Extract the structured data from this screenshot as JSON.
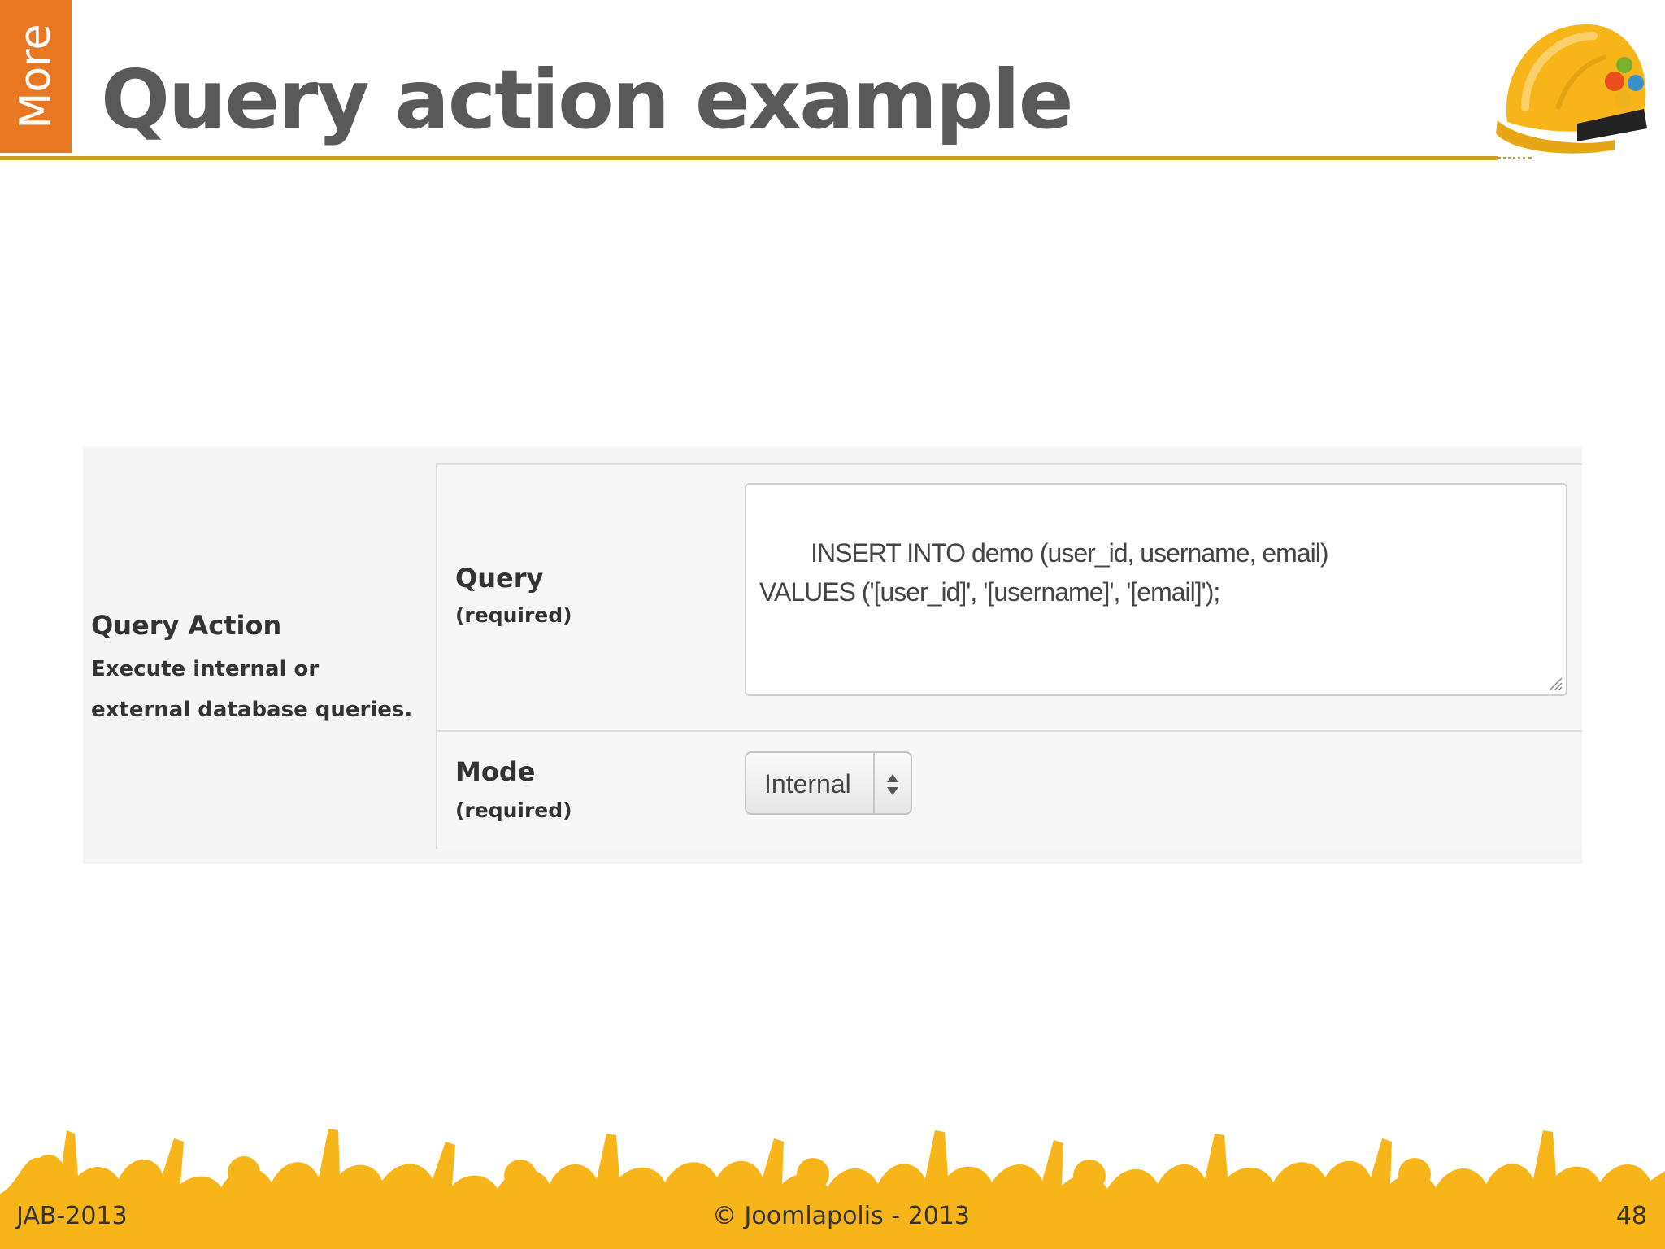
{
  "header": {
    "side_tab": "More",
    "title": "Query action example"
  },
  "panel": {
    "group_title": "Query Action",
    "group_description": "Execute internal or external database queries.",
    "query": {
      "label": "Query",
      "required": "(required)",
      "value": "INSERT INTO demo (user_id, username, email)\nVALUES ('[user_id]', '[username]', '[email]');"
    },
    "mode": {
      "label": "Mode",
      "required": "(required)",
      "selected": "Internal"
    }
  },
  "footer": {
    "left": "JAB-2013",
    "center": "© Joomlapolis - 2013",
    "page": "48"
  },
  "icons": {
    "helmet": "construction-helmet-icon",
    "select_arrows": "select-updown-icon",
    "resize": "resize-grip-icon"
  },
  "colors": {
    "accent_orange": "#e87722",
    "rule_gold": "#c8a01c",
    "crowd_yellow": "#f7b519",
    "title_gray": "#595959"
  }
}
